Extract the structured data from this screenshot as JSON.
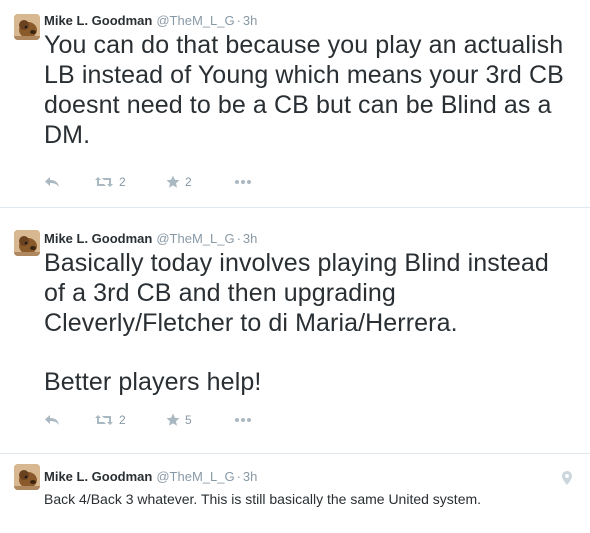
{
  "tweets": [
    {
      "name": "Mike L. Goodman",
      "handle": "@TheM_L_G",
      "time": "3h",
      "text": "You can do that because you play an actualish LB instead of Young which means your 3rd CB doesnt need to be a CB but can be Blind as a DM.",
      "retweets": "2",
      "favorites": "2"
    },
    {
      "name": "Mike L. Goodman",
      "handle": "@TheM_L_G",
      "time": "3h",
      "text_p1": "Basically today involves playing Blind instead of a 3rd CB and then upgrading Cleverly/Fletcher to di Maria/Herrera.",
      "text_p2": "Better players help!",
      "retweets": "2",
      "favorites": "5"
    },
    {
      "name": "Mike L. Goodman",
      "handle": "@TheM_L_G",
      "time": "3h",
      "text": "Back 4/Back 3 whatever. This is still basically the same United system."
    }
  ],
  "separator": "·",
  "icons": {
    "reply": "reply-icon",
    "retweet": "retweet-icon",
    "favorite": "star-icon",
    "more": "more-icon",
    "geo": "location-pin-icon"
  },
  "colors": {
    "text": "#292f33",
    "muted": "#8899a6",
    "icon": "#aab8c2",
    "border": "#e1e8ed"
  }
}
